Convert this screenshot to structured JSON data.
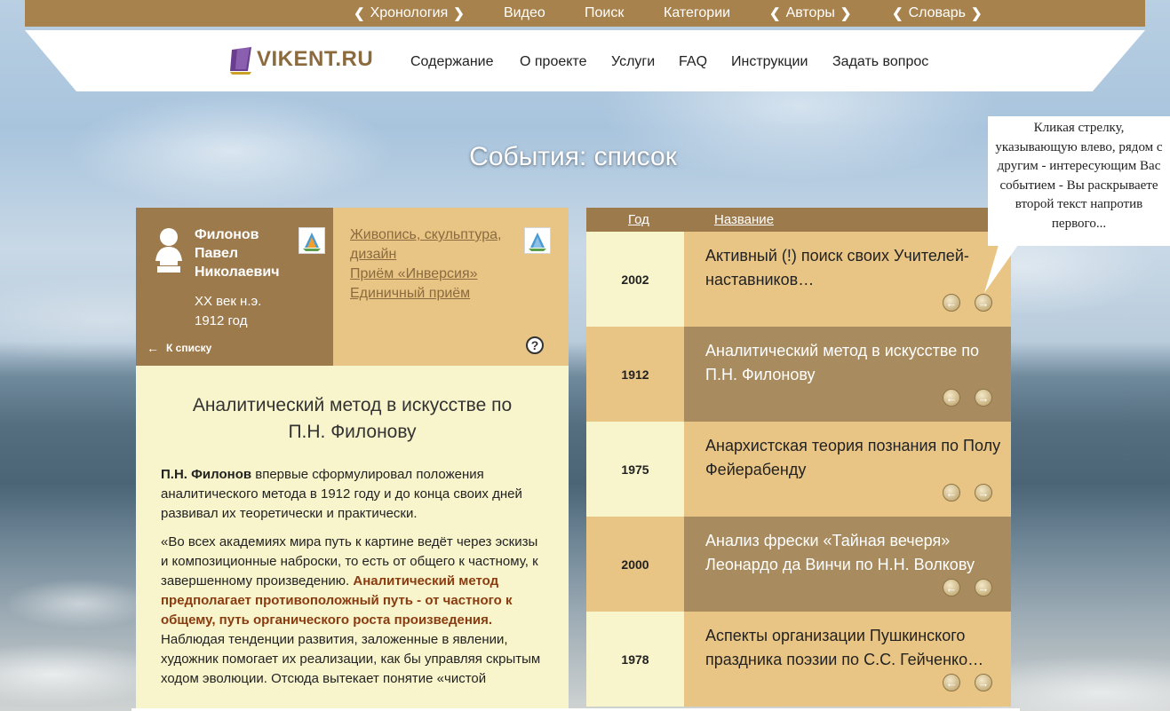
{
  "top_menu": {
    "chronology": "Хронология",
    "video": "Видео",
    "search": "Поиск",
    "categories": "Категории",
    "authors": "Авторы",
    "dictionary": "Словарь"
  },
  "logo": {
    "text": "VIKENT.RU"
  },
  "nav": {
    "contents": "Содержание",
    "about": "О проекте",
    "services": "Услуги",
    "faq": "FAQ",
    "instructions": "Инструкции",
    "ask": "Задать вопрос"
  },
  "page_title": "События: список",
  "author": {
    "name_line1": "Филонов",
    "name_line2": "Павел",
    "name_line3": "Николаевич",
    "era": "XX век н.э.",
    "year": "1912 год",
    "back_label": "К списку"
  },
  "categories": {
    "link1": "Живопись, скульптура, дизайн",
    "link2": "Приём «Инверсия»",
    "link3": "Единичный приём"
  },
  "help_label": "?",
  "article": {
    "title": "Аналитический метод в искусстве по П.Н. Филонову",
    "p1_bold": "П.Н. Филонов",
    "p1_rest": " впервые сформулировал положения аналитического метода в 1912 году и до конца своих дней развивал их теоретически и практически.",
    "p2_start": "«Во всех академиях мира путь к картине ведёт через эскизы и композиционные наброски, то  есть от общего к частному, к завершенному произведению. ",
    "p2_highlight": "Аналитический метод предполагает противоположный путь - от частного к общему, путь органического роста произведения.",
    "p2_end": " Наблюдая тенденции развития, заложенные в явлении, художник помогает их реализации, как бы управляя скрытым ходом эволюции. Отсюда вытекает понятие «чистой"
  },
  "table": {
    "col_year": "Год",
    "col_title": "Название",
    "rows": [
      {
        "year": "2002",
        "title": "Активный (!) поиск своих Учителей-наставников…"
      },
      {
        "year": "1912",
        "title": "Аналитический метод в искусстве по П.Н. Филонову"
      },
      {
        "year": "1975",
        "title": "Анархистская теория познания по Полу Фейерабенду"
      },
      {
        "year": "2000",
        "title": "Анализ фрески «Тайная вечеря» Леонардо да Винчи по Н.Н. Волкову"
      },
      {
        "year": "1978",
        "title": "Аспекты организации Пушкинского праздника поэзии по С.С. Гейченко…"
      }
    ]
  },
  "tooltip": {
    "text": "Кликая стрелку, указывающую влево, рядом с другим - интересующим Вас событием - Вы раскрываете второй текст напротив первого..."
  },
  "icons": {
    "arrow_left": "arrow-left-icon",
    "arrow_right": "arrow-right-icon",
    "sail": "sail-logo-icon",
    "help": "help-icon"
  },
  "colors": {
    "brown": "#9d7a4c",
    "topbar": "#a7824c",
    "tan": "#e9c585",
    "cream": "#f8f5cc",
    "dark_row": "#a88b5e",
    "link": "#8a6a3f",
    "highlight": "#8a3b10"
  }
}
